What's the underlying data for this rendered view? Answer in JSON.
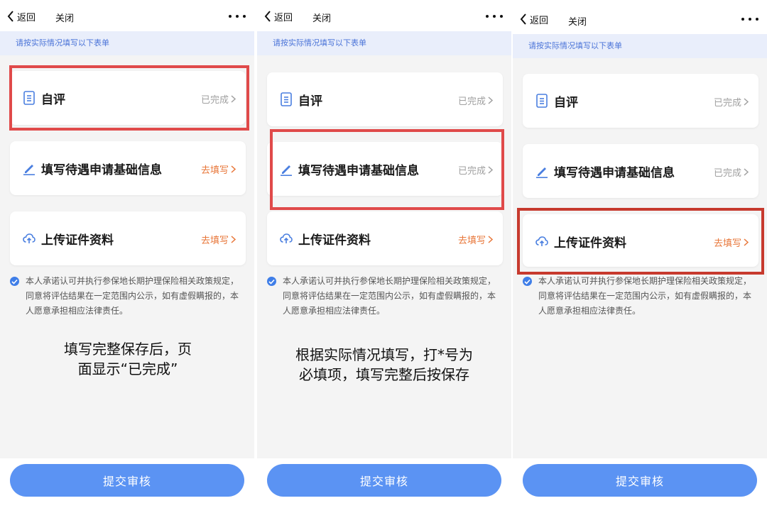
{
  "nav": {
    "back_label": "返回",
    "close_label": "关闭"
  },
  "hint": "请按实际情况填写以下表单",
  "items": {
    "self_eval": "自评",
    "basic_info": "填写待遇申请基础信息",
    "upload": "上传证件资料"
  },
  "status": {
    "done": "已完成",
    "todo": "去填写"
  },
  "agreement": "本人承诺认可并执行参保地长期护理保险相关政策规定，同意将评估结果在一定范围内公示，如有虚假瞒报的，本人愿意承担相应法律责任。",
  "submit_label": "提交审核",
  "tips": {
    "panel1": [
      "填写完整保存后，页",
      "面显示“已完成”"
    ],
    "panel2": [
      "根据实际情况填写，打*号为",
      "必填项，填写完整后按保存"
    ]
  },
  "colors": {
    "highlight": "#e04a4a",
    "accent": "#5b93f3",
    "todo": "#e8773a",
    "hint_text": "#4b74d8"
  }
}
